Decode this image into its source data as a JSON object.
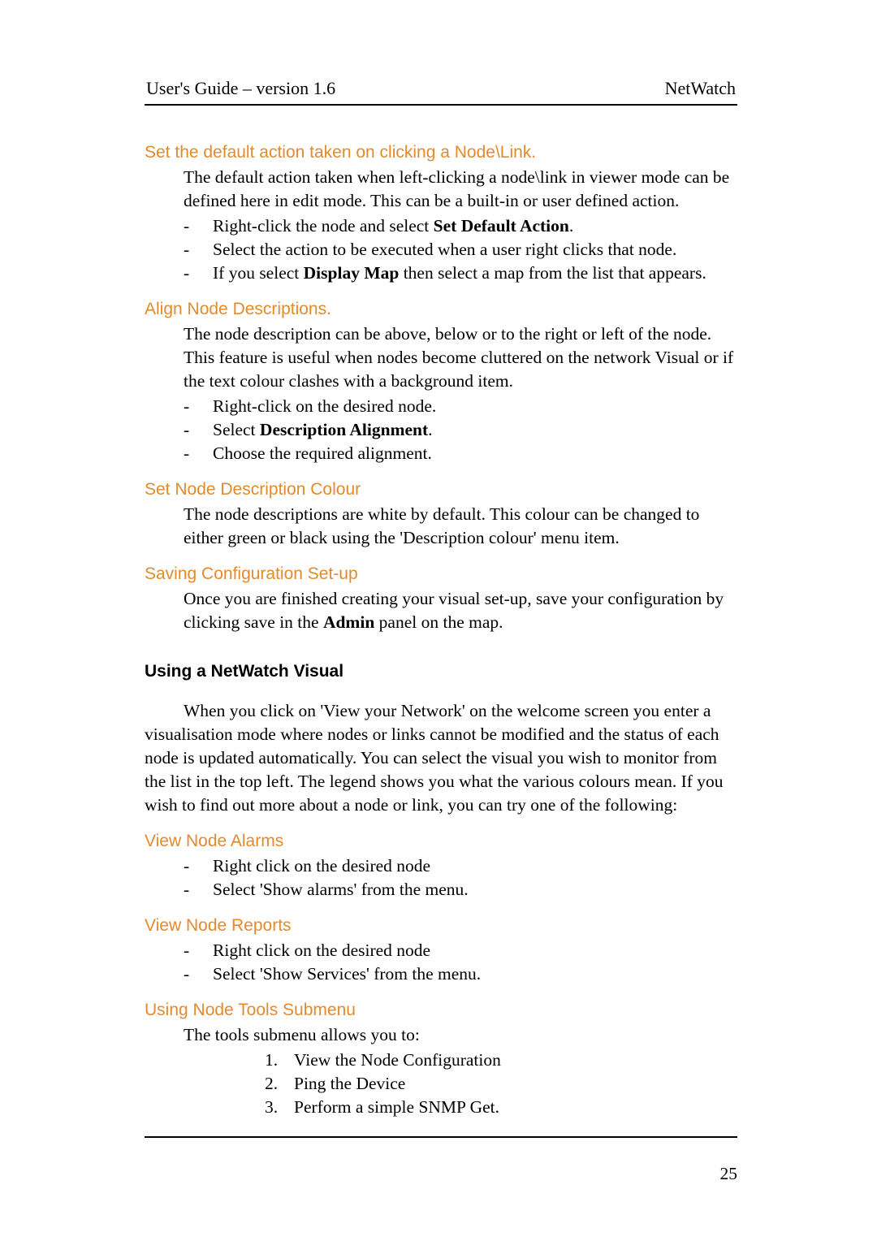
{
  "header": {
    "left": "User's Guide – version 1.6",
    "right": "NetWatch"
  },
  "sections": {
    "s1": {
      "title": "Set the default action taken on clicking a Node\\Link.",
      "intro": "The default action taken when left-clicking a node\\link in viewer mode can be defined here in edit mode. This can be a built-in or user defined action.",
      "items": [
        {
          "pre": "Right-click the node and select ",
          "bold": "Set Default Action",
          "post": "."
        },
        {
          "pre": "Select the action to be executed when a user right clicks that node.",
          "bold": "",
          "post": ""
        },
        {
          "pre": "If you select ",
          "bold": "Display Map",
          "post": " then select a map from the list that appears."
        }
      ]
    },
    "s2": {
      "title": "Align Node Descriptions.",
      "intro": "The node description can be above, below or to the right or left of the node. This feature is useful when nodes become cluttered on the network Visual or if the text colour clashes with a background item.",
      "items": [
        {
          "pre": "Right-click on the desired node.",
          "bold": "",
          "post": ""
        },
        {
          "pre": "Select ",
          "bold": "Description Alignment",
          "post": "."
        },
        {
          "pre": "Choose the required alignment.",
          "bold": "",
          "post": ""
        }
      ]
    },
    "s3": {
      "title": "Set Node Description Colour",
      "intro": "The node descriptions are white by default. This colour can be changed to either green or black using the 'Description colour' menu item."
    },
    "s4": {
      "title": "Saving Configuration Set-up",
      "intro_pre": "Once you are finished creating your visual set-up, save your configuration by clicking save in the ",
      "intro_bold": "Admin",
      "intro_post": " panel on the map."
    },
    "main": {
      "title": "Using a NetWatch Visual",
      "para": "When you click on 'View your Network' on the welcome screen you enter a visualisation mode where nodes or links cannot be modified and the status of each node is updated automatically. You can select the visual you wish to monitor from the list in the top left. The legend shows you what the various colours mean. If you wish to find out more about a node or link, you can try one of the following:"
    },
    "s5": {
      "title": "View Node Alarms",
      "items": [
        "Right click on the desired node",
        "Select 'Show alarms' from the menu."
      ]
    },
    "s6": {
      "title": "View Node Reports",
      "items": [
        "Right click on the desired node",
        "Select 'Show Services' from the menu."
      ]
    },
    "s7": {
      "title": "Using Node Tools Submenu",
      "intro": "The tools submenu allows you to:",
      "items": [
        {
          "n": "1.",
          "t": "View the Node Configuration"
        },
        {
          "n": "2.",
          "t": "Ping the Device"
        },
        {
          "n": "3.",
          "t": "Perform a simple SNMP Get."
        }
      ]
    }
  },
  "page_number": "25"
}
